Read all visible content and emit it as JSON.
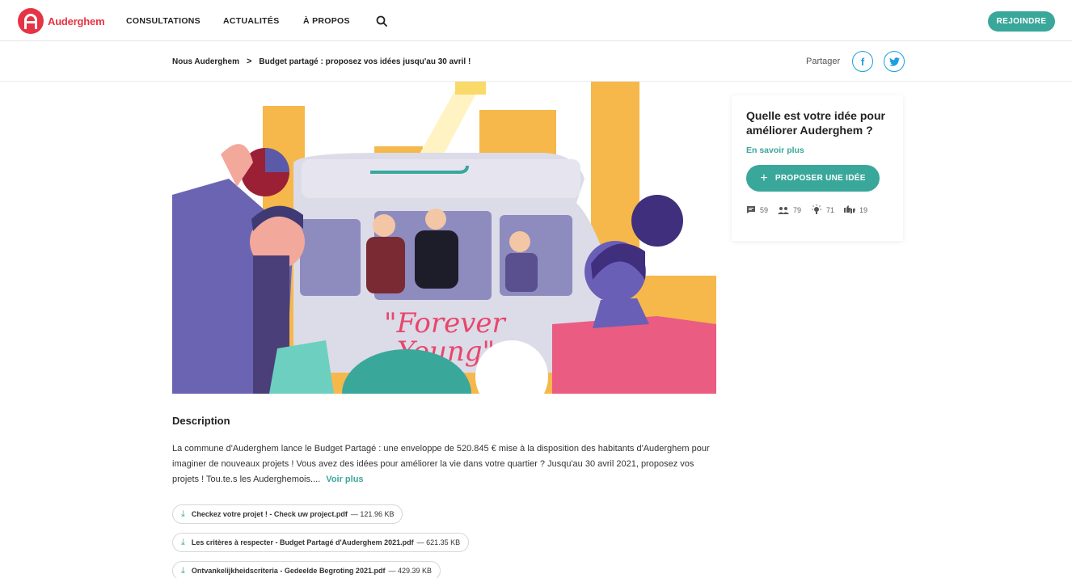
{
  "brand": {
    "name": "Auderghem",
    "color": "#e63445"
  },
  "accent": "#3aa79b",
  "nav": {
    "items": [
      "CONSULTATIONS",
      "ACTUALITÉS",
      "À PROPOS"
    ],
    "search_icon": "search-icon",
    "join_label": "REJOINDRE"
  },
  "breadcrumb": {
    "home": "Nous Auderghem",
    "separator": ">",
    "current": "Budget partagé : proposez vos idées jusqu'au 30 avril !"
  },
  "share": {
    "label": "Partager",
    "facebook": "f",
    "twitter_icon": "twitter-icon"
  },
  "hero": {
    "mural_text_line1": "Forever",
    "mural_text_line2": "Young\"",
    "mural_text_quote": "\""
  },
  "card": {
    "title": "Quelle est votre idée pour améliorer Auderghem ?",
    "more_link": "En savoir plus",
    "propose_label": "PROPOSER UNE IDÉE",
    "stats": {
      "comments": "59",
      "participants": "79",
      "ideas": "71",
      "votes": "19"
    }
  },
  "description": {
    "title": "Description",
    "text": "La commune d'Auderghem lance le Budget Partagé : une enveloppe de 520.845 € mise à la disposition des habitants d'Auderghem pour imaginer de nouveaux projets ! Vous avez des idées pour améliorer la vie dans votre quartier ? Jusqu'au 30 avril 2021, proposez vos projets ! Tou.te.s les Auderghemois....",
    "read_more": "Voir plus"
  },
  "files": [
    {
      "name": "Checkez votre projet ! - Check uw project.pdf",
      "size": "— 121.96 KB"
    },
    {
      "name": "Les critères à respecter - Budget Partagé d'Auderghem 2021.pdf",
      "size": "— 621.35 KB"
    },
    {
      "name": "Ontvankelijkheidscriteria - Gedeelde Begroting 2021.pdf",
      "size": "— 429.39 KB"
    }
  ]
}
